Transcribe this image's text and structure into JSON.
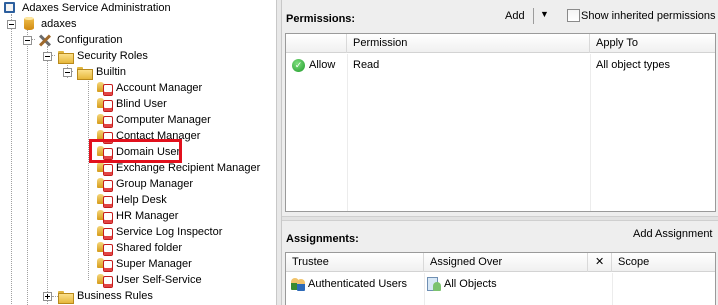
{
  "tree": {
    "root": "Adaxes Service Administration",
    "service": "adaxes",
    "configuration": "Configuration",
    "security_roles": "Security Roles",
    "builtin": "Builtin",
    "roles": [
      "Account Manager",
      "Blind User",
      "Computer Manager",
      "Contact Manager",
      "Domain User",
      "Exchange Recipient Manager",
      "Group Manager",
      "Help Desk",
      "HR Manager",
      "Service Log Inspector",
      "Shared folder",
      "Super Manager",
      "User Self-Service"
    ],
    "business_rules": "Business Rules",
    "highlighted_role": "Domain User"
  },
  "permissions": {
    "title": "Permissions:",
    "add_label": "Add",
    "show_inherited_label": "Show inherited permissions",
    "columns": [
      "",
      "Permission",
      "Apply To"
    ],
    "rows": [
      {
        "type": "Allow",
        "permission": "Read",
        "apply_to": "All object types"
      }
    ]
  },
  "assignments": {
    "title": "Assignments:",
    "add_label": "Add Assignment",
    "columns": [
      "Trustee",
      "Assigned Over",
      "✕",
      "Scope"
    ],
    "rows": [
      {
        "trustee": "Authenticated Users",
        "assigned_over": "All Objects",
        "scope": ""
      }
    ]
  },
  "colors": {
    "highlight": "#e2101c",
    "panel": "#eeeeee"
  }
}
